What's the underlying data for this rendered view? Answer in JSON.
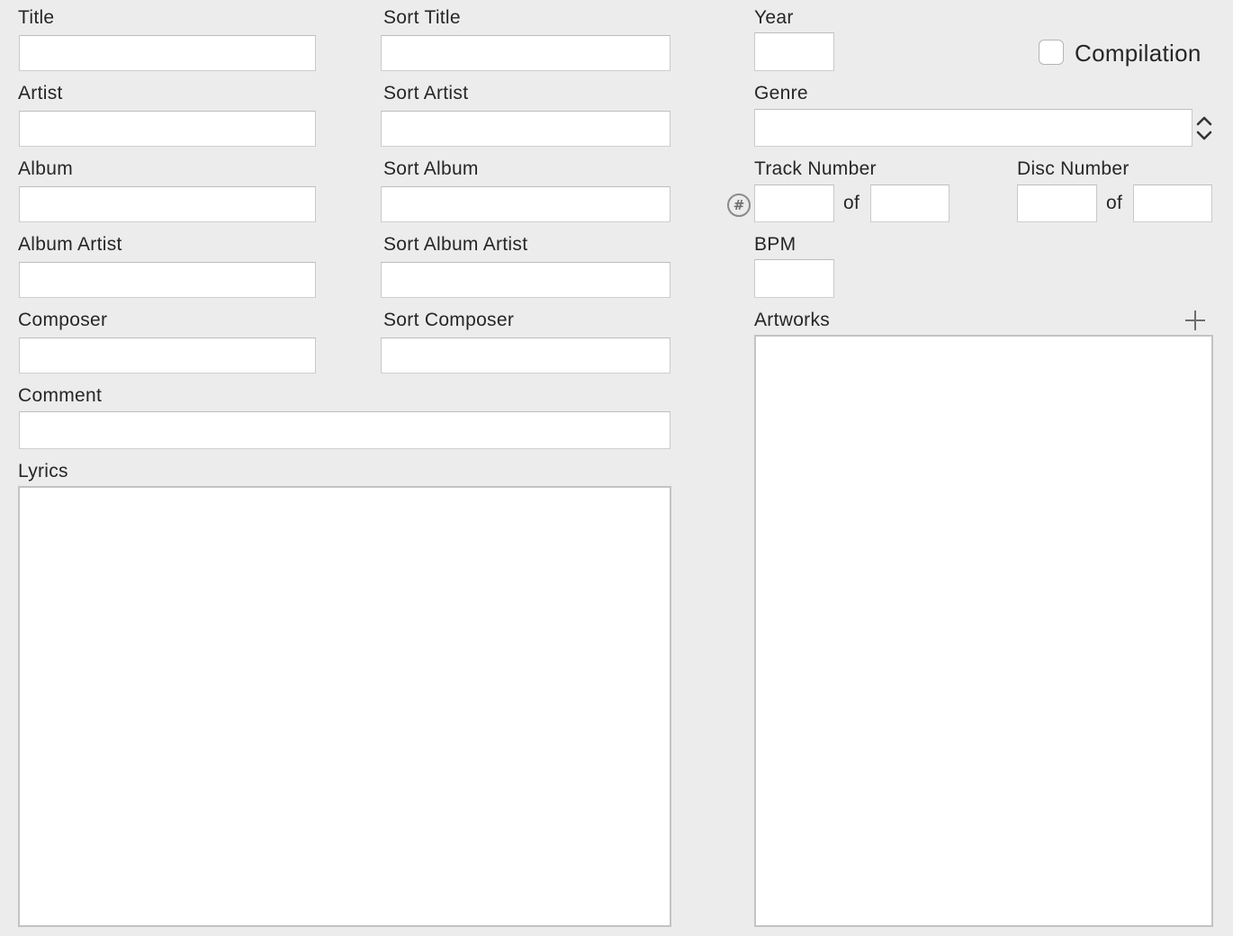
{
  "labels": {
    "title": "Title",
    "sort_title": "Sort Title",
    "year": "Year",
    "artist": "Artist",
    "sort_artist": "Sort Artist",
    "genre": "Genre",
    "album": "Album",
    "sort_album": "Sort Album",
    "track_number": "Track Number",
    "disc_number": "Disc Number",
    "album_artist": "Album Artist",
    "sort_album_artist": "Sort Album Artist",
    "bpm": "BPM",
    "composer": "Composer",
    "sort_composer": "Sort Composer",
    "artworks": "Artworks",
    "comment": "Comment",
    "lyrics": "Lyrics",
    "of": "of",
    "compilation": "Compilation"
  },
  "values": {
    "title": "",
    "sort_title": "",
    "year": "",
    "artist": "",
    "sort_artist": "",
    "genre": "",
    "album": "",
    "sort_album": "",
    "track_number": "",
    "track_total": "",
    "disc_number": "",
    "disc_total": "",
    "album_artist": "",
    "sort_album_artist": "",
    "bpm": "",
    "composer": "",
    "sort_composer": "",
    "comment": "",
    "lyrics": "",
    "compilation": false
  },
  "icons": {
    "track_auto_number": "hash-circle-icon",
    "genre_stepper": "up-down-chevron-icon",
    "add_artwork": "plus-icon"
  },
  "colors": {
    "background": "#ececec",
    "field_background": "#ffffff",
    "field_border": "#c9c9c9",
    "text": "#262626",
    "icon": "#6e6e6e"
  }
}
